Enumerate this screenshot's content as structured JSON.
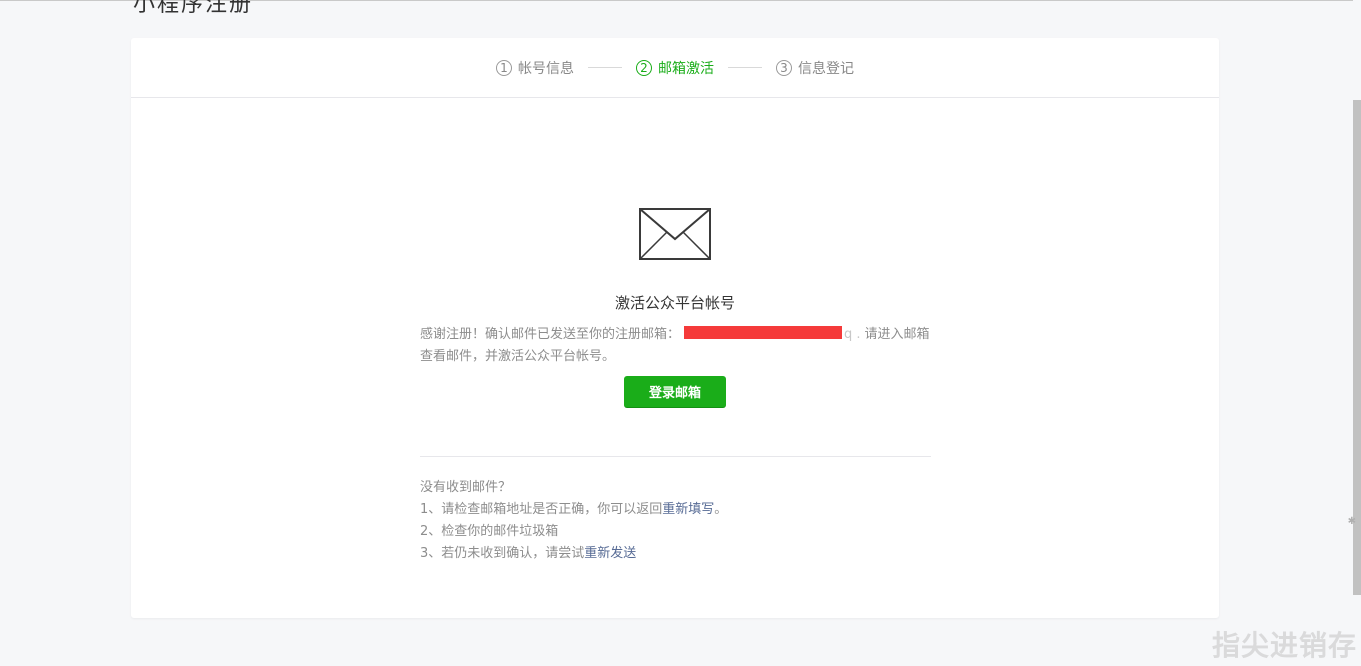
{
  "header": {
    "page_title_partial": "小程序注册"
  },
  "steps": [
    {
      "num": "1",
      "label": "帐号信息",
      "active": false
    },
    {
      "num": "2",
      "label": "邮箱激活",
      "active": true
    },
    {
      "num": "3",
      "label": "信息登记",
      "active": false
    }
  ],
  "main": {
    "icon": "envelope-icon",
    "title": "激活公众平台帐号",
    "desc_before": "感谢注册！确认邮件已发送至你的注册邮箱：",
    "email_tail": "q  .",
    "desc_after": "请进入邮箱查看邮件，并激活公众平台帐号。",
    "login_button": "登录邮箱"
  },
  "help": {
    "heading": "没有收到邮件？",
    "line1_prefix": "1、请检查邮箱地址是否正确，你可以返回",
    "line1_link": "重新填写",
    "line1_suffix": "。",
    "line2": "2、检查你的邮件垃圾箱",
    "line3_prefix": "3、若仍未收到确认，请尝试",
    "line3_link": "重新发送"
  },
  "colors": {
    "accent": "#1aad19",
    "link": "#576b95",
    "redaction": "#f53a3a"
  },
  "watermark": "指尖进销存"
}
